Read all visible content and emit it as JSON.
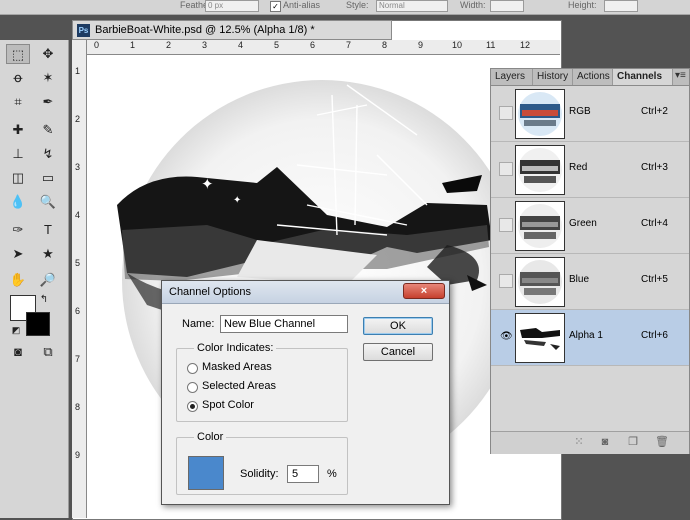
{
  "options_bar": {
    "feather_label": "Feather:",
    "feather_value": "0 px",
    "antialias_label": "Anti-alias",
    "style_label": "Style:",
    "style_value": "Normal",
    "width_label": "Width:",
    "height_label": "Height:"
  },
  "document": {
    "tab_title": "BarbieBoat-White.psd @ 12.5% (Alpha 1/8) *",
    "ruler_ticks": [
      "0",
      "1",
      "2",
      "3",
      "4",
      "5",
      "6",
      "7",
      "8",
      "9",
      "10",
      "11",
      "12"
    ],
    "vruler_ticks": [
      "1",
      "2",
      "3",
      "4",
      "5",
      "6",
      "7",
      "8",
      "9"
    ]
  },
  "panel": {
    "tabs": [
      "Layers",
      "History",
      "Actions",
      "Channels"
    ],
    "active_tab": "Channels",
    "channels": [
      {
        "name": "RGB",
        "shortcut": "Ctrl+2",
        "visible": false,
        "selected": false
      },
      {
        "name": "Red",
        "shortcut": "Ctrl+3",
        "visible": false,
        "selected": false
      },
      {
        "name": "Green",
        "shortcut": "Ctrl+4",
        "visible": false,
        "selected": false
      },
      {
        "name": "Blue",
        "shortcut": "Ctrl+5",
        "visible": false,
        "selected": false
      },
      {
        "name": "Alpha 1",
        "shortcut": "Ctrl+6",
        "visible": true,
        "selected": true
      }
    ]
  },
  "dialog": {
    "title": "Channel Options",
    "close_glyph": "×",
    "name_label": "Name:",
    "name_value": "New Blue Channel",
    "ok_label": "OK",
    "cancel_label": "Cancel",
    "color_indicates_label": "Color Indicates:",
    "options": [
      "Masked Areas",
      "Selected Areas",
      "Spot Color"
    ],
    "selected_option": "Spot Color",
    "color_label": "Color",
    "swatch_color": "#4a88cc",
    "solidity_label": "Solidity:",
    "solidity_value": "5",
    "solidity_unit": "%"
  }
}
